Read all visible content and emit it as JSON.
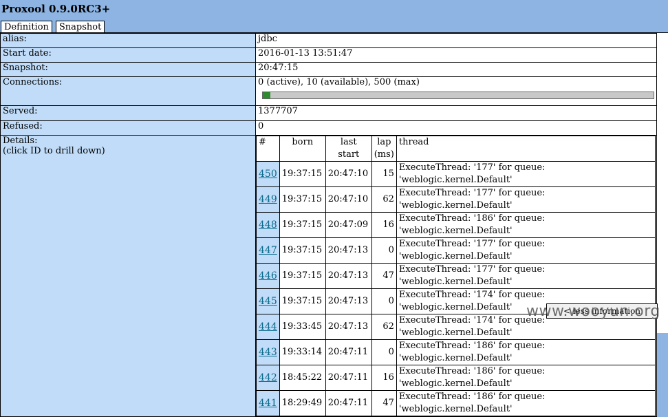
{
  "app_title": "Proxool 0.9.0RC3+",
  "tabs": [
    {
      "label": "Definition"
    },
    {
      "label": "Snapshot"
    }
  ],
  "rows": {
    "alias": {
      "label": "alias:",
      "value": "jdbc"
    },
    "start_date": {
      "label": "Start date:",
      "value": "2016-01-13 13:51:47"
    },
    "snapshot": {
      "label": "Snapshot:",
      "value": "20:47:15"
    },
    "connections": {
      "label": "Connections:",
      "value": "0 (active), 10 (available), 500 (max)",
      "available_fraction": 0.02
    },
    "served": {
      "label": "Served:",
      "value": "1377707"
    },
    "refused": {
      "label": "Refused:",
      "value": "0"
    },
    "details": {
      "label": "Details:",
      "sublabel": "(click ID to drill down)"
    }
  },
  "details_table": {
    "headers": {
      "id": "#",
      "born": "born",
      "last_start_1": "last",
      "last_start_2": "start",
      "lap_1": "lap",
      "lap_2": "(ms)",
      "thread": "thread"
    },
    "rows": [
      {
        "id": "450",
        "born": "19:37:15",
        "last": "20:47:10",
        "lap": "15",
        "thread": "ExecuteThread: '177' for queue: 'weblogic.kernel.Default'"
      },
      {
        "id": "449",
        "born": "19:37:15",
        "last": "20:47:10",
        "lap": "62",
        "thread": "ExecuteThread: '177' for queue: 'weblogic.kernel.Default'"
      },
      {
        "id": "448",
        "born": "19:37:15",
        "last": "20:47:09",
        "lap": "16",
        "thread": "ExecuteThread: '186' for queue: 'weblogic.kernel.Default'"
      },
      {
        "id": "447",
        "born": "19:37:15",
        "last": "20:47:13",
        "lap": "0",
        "thread": "ExecuteThread: '177' for queue: 'weblogic.kernel.Default'"
      },
      {
        "id": "446",
        "born": "19:37:15",
        "last": "20:47:13",
        "lap": "47",
        "thread": "ExecuteThread: '177' for queue: 'weblogic.kernel.Default'"
      },
      {
        "id": "445",
        "born": "19:37:15",
        "last": "20:47:13",
        "lap": "0",
        "thread": "ExecuteThread: '174' for queue: 'weblogic.kernel.Default'"
      },
      {
        "id": "444",
        "born": "19:33:45",
        "last": "20:47:13",
        "lap": "62",
        "thread": "ExecuteThread: '174' for queue: 'weblogic.kernel.Default'"
      },
      {
        "id": "443",
        "born": "19:33:14",
        "last": "20:47:11",
        "lap": "0",
        "thread": "ExecuteThread: '186' for queue: 'weblogic.kernel.Default'"
      },
      {
        "id": "442",
        "born": "18:45:22",
        "last": "20:47:11",
        "lap": "16",
        "thread": "ExecuteThread: '186' for queue: 'weblogic.kernel.Default'"
      },
      {
        "id": "441",
        "born": "18:29:49",
        "last": "20:47:11",
        "lap": "47",
        "thread": "ExecuteThread: '186' for queue: 'weblogic.kernel.Default'"
      }
    ]
  },
  "footer_button": "< less information",
  "watermark": "www.wooyun.org"
}
